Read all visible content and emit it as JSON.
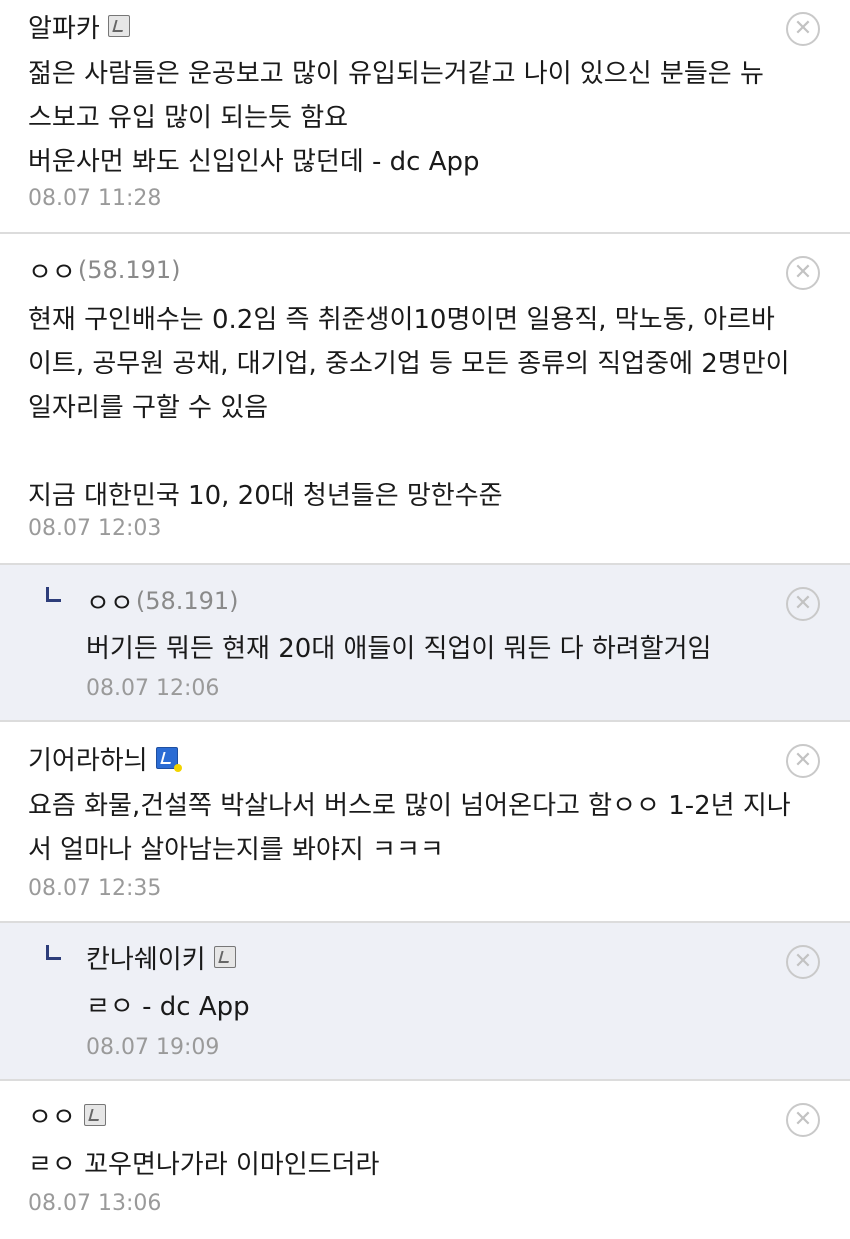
{
  "comments": [
    {
      "nick": "알파카",
      "ip": "",
      "lines": [
        "젊은 사람들은 운공보고 많이 유입되는거같고 나이 있으신 분들은 뉴",
        "스보고 유입 많이 되는듯 함요",
        "버운사먼 봐도 신입인사 많던데 - dc App"
      ],
      "time": "08.07 11:28"
    },
    {
      "nick": "ㅇㅇ",
      "ip": "(58.191)",
      "lines": [
        "현재 구인배수는 0.2임 즉 취준생이10명이면 일용직, 막노동, 아르바",
        "이트, 공무원 공채, 대기업, 중소기업 등 모든 종류의 직업중에 2명만이",
        "일자리를 구할 수 있음",
        "",
        "지금 대한민국 10, 20대 청년들은 망한수준"
      ],
      "time": "08.07 12:03"
    },
    {
      "nick": "ㅇㅇ",
      "ip": "(58.191)",
      "lines": [
        "버기든 뭐든 현재 20대 애들이 직업이 뭐든 다 하려할거임"
      ],
      "time": "08.07 12:06"
    },
    {
      "nick": "기어라하늬",
      "ip": "",
      "lines": [
        "요즘 화물,건설쪽 박살나서 버스로 많이 넘어온다고 함ㅇㅇ 1-2년 지나",
        "서 얼마나 살아남는지를 봐야지 ㅋㅋㅋ"
      ],
      "time": "08.07 12:35"
    },
    {
      "nick": "칸나쉐이키",
      "ip": "",
      "lines": [
        "ㄹㅇ - dc App"
      ],
      "time": "08.07 19:09"
    },
    {
      "nick": "ㅇㅇ",
      "ip": "",
      "lines": [
        "ㄹㅇ 꼬우면나가라 이마인드더라"
      ],
      "time": "08.07 13:06"
    }
  ],
  "icons": {
    "close": "circle-x-icon",
    "reply": "reply-corner-icon",
    "badge": "gallery-member-icon"
  },
  "colors": {
    "reply_bg": "#eef0f6",
    "reply_mark": "#2d3d7a",
    "time": "#9a9a9a",
    "ip": "#8a8a8a"
  }
}
